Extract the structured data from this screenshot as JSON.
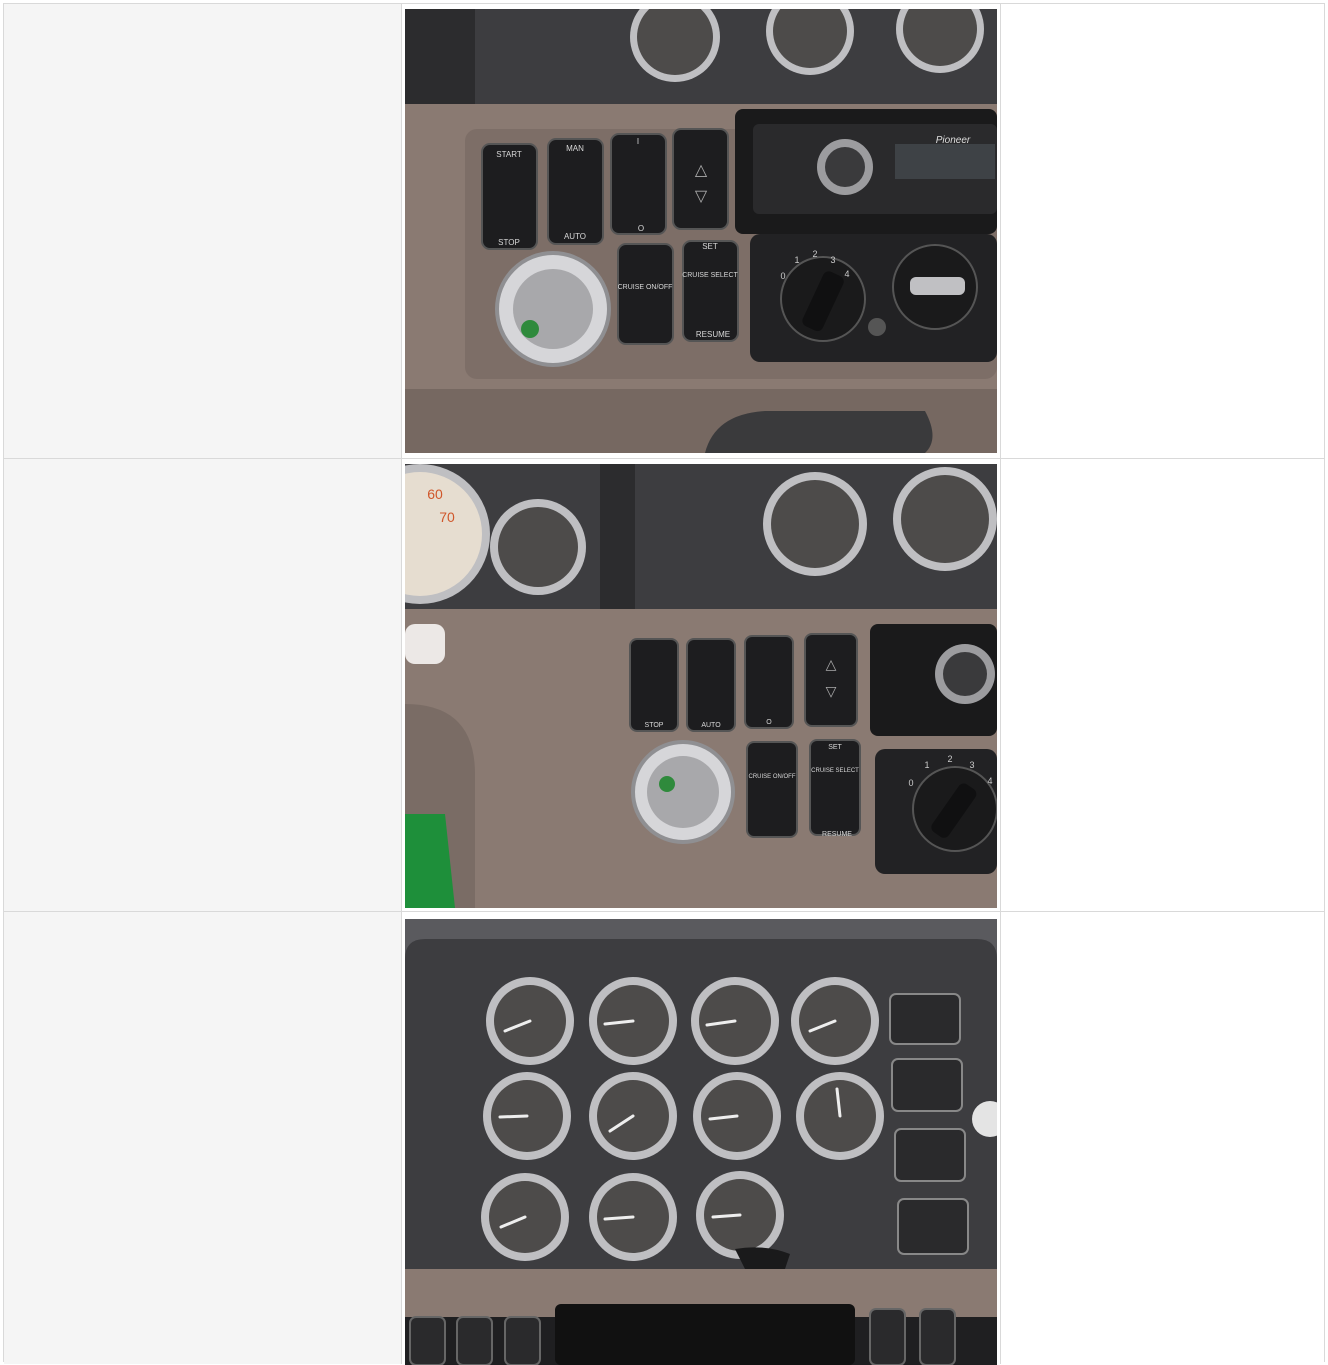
{
  "rows": [
    {
      "photo": {
        "alt": "",
        "switch_top_labels": [
          "START",
          "MAN",
          "I",
          ""
        ],
        "switch_bottom_labels": [
          "STOP",
          "AUTO",
          "O",
          ""
        ],
        "cruise_onoff": "CRUISE ON/OFF",
        "cruise_select": "CRUISE SELECT",
        "set_label": "SET",
        "resume_label": "RESUME",
        "radio_brand": "Pioneer",
        "fan_numbers": [
          "0",
          "1",
          "2",
          "3",
          "4"
        ]
      }
    },
    {
      "photo": {
        "alt": "",
        "speedo_numbers": [
          "60",
          "70"
        ],
        "switch_bottom_labels": [
          "STOP",
          "AUTO",
          "O",
          ""
        ],
        "cruise_onoff": "CRUISE ON/OFF",
        "cruise_select": "CRUISE SELECT",
        "set_label": "SET",
        "resume_label": "RESUME",
        "fan_numbers": [
          "0",
          "1",
          "2",
          "3",
          "4"
        ]
      }
    },
    {
      "photo": {
        "alt": ""
      }
    }
  ],
  "colors": {
    "dash_brown": "#8a7a72",
    "dash_dark": "#3b3b3d",
    "switch_black": "#1d1d1f",
    "chrome": "#c9c9cc",
    "page_bg": "#f5f5f5",
    "border": "#d9d9d9"
  }
}
